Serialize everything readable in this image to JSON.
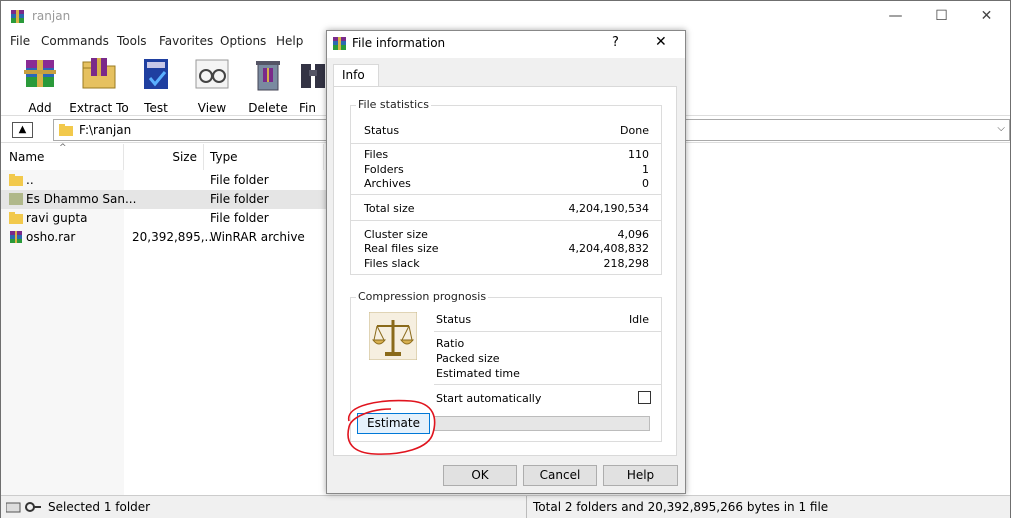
{
  "window": {
    "title": "ranjan",
    "controls": {
      "minimize": "—",
      "maximize": "☐",
      "close": "✕"
    }
  },
  "menu": [
    "File",
    "Commands",
    "Tools",
    "Favorites",
    "Options",
    "Help"
  ],
  "toolbar": {
    "add": "Add",
    "extract_to": "Extract To",
    "test": "Test",
    "view": "View",
    "delete": "Delete",
    "find": "Fin"
  },
  "address": {
    "path": "F:\\ranjan"
  },
  "columns": {
    "name": "Name",
    "size": "Size",
    "type": "Type"
  },
  "files": [
    {
      "name": "..",
      "size": "",
      "type": "File folder"
    },
    {
      "name": "Es Dhammo San...",
      "size": "",
      "type": "File folder"
    },
    {
      "name": "ravi gupta",
      "size": "",
      "type": "File folder"
    },
    {
      "name": "osho.rar",
      "size": "20,392,895,...",
      "type": "WinRAR archive"
    }
  ],
  "status": {
    "left": "Selected 1 folder",
    "right": "Total 2 folders and 20,392,895,266 bytes in 1 file"
  },
  "dialog": {
    "title": "File information",
    "help_glyph": "?",
    "close_glyph": "✕",
    "tab_info": "Info",
    "stats": {
      "group_title": "File statistics",
      "status_label": "Status",
      "status_value": "Done",
      "files_label": "Files",
      "files_value": "110",
      "folders_label": "Folders",
      "folders_value": "1",
      "archives_label": "Archives",
      "archives_value": "0",
      "total_label": "Total size",
      "total_value": "4,204,190,534",
      "cluster_label": "Cluster size",
      "cluster_value": "4,096",
      "real_label": "Real files size",
      "real_value": "4,204,408,832",
      "slack_label": "Files slack",
      "slack_value": "218,298"
    },
    "prognosis": {
      "group_title": "Compression prognosis",
      "status_label": "Status",
      "status_value": "Idle",
      "ratio_label": "Ratio",
      "packed_label": "Packed size",
      "time_label": "Estimated time",
      "auto_label": "Start automatically",
      "auto_checked": false,
      "estimate_label": "Estimate"
    },
    "buttons": {
      "ok": "OK",
      "cancel": "Cancel",
      "help": "Help"
    }
  },
  "colors": {
    "accent": "#0078d7",
    "annotation": "#e0141e",
    "selected_row": "#e5e5e5"
  }
}
